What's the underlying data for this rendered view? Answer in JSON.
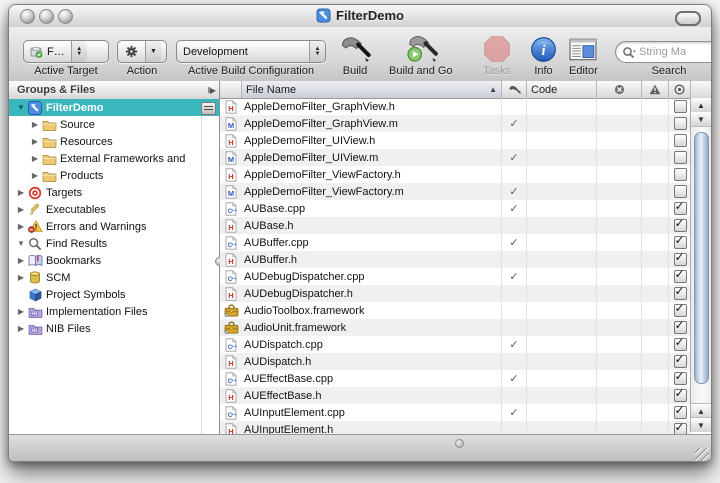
{
  "colors": {
    "selection": "#39b7bd",
    "thumb_blue": "#9db2cc",
    "info_blue": "#2f6fd1"
  },
  "window": {
    "title": "FilterDemo",
    "icon": "xcode-document-icon"
  },
  "toolbar": {
    "active_target": {
      "value": "F…",
      "label": "Active Target",
      "icon": "active-target-icon"
    },
    "action": {
      "label": "Action",
      "icon": "gear-icon"
    },
    "build_config": {
      "value": "Development",
      "label": "Active Build Configuration"
    },
    "build": {
      "label": "Build",
      "icon": "hammer-icon"
    },
    "build_and_go": {
      "label": "Build and Go",
      "icon": "hammer-go-icon"
    },
    "tasks": {
      "label": "Tasks",
      "icon": "stop-octagon-icon",
      "enabled": false
    },
    "info": {
      "label": "Info",
      "icon": "info-icon"
    },
    "editor": {
      "label": "Editor",
      "icon": "editor-window-icon"
    },
    "search": {
      "label": "Search",
      "value": "String Ma",
      "icon": "search-icon"
    }
  },
  "sidebar": {
    "header": "Groups & Files",
    "splitter_icon": "column-split-icon",
    "items": [
      {
        "label": "FilterDemo",
        "icon": "xcode-project-icon",
        "level": 0,
        "disclosure": "expanded",
        "selected": true
      },
      {
        "label": "Source",
        "icon": "folder-icon",
        "level": 1,
        "disclosure": "collapsed",
        "selected": false
      },
      {
        "label": "Resources",
        "icon": "folder-icon",
        "level": 1,
        "disclosure": "collapsed",
        "selected": false
      },
      {
        "label": "External Frameworks and",
        "icon": "folder-icon",
        "level": 1,
        "disclosure": "collapsed",
        "selected": false
      },
      {
        "label": "Products",
        "icon": "folder-icon",
        "level": 1,
        "disclosure": "collapsed",
        "selected": false
      },
      {
        "label": "Targets",
        "icon": "targets-icon",
        "level": 0,
        "disclosure": "collapsed",
        "selected": false
      },
      {
        "label": "Executables",
        "icon": "executables-icon",
        "level": 0,
        "disclosure": "collapsed",
        "selected": false
      },
      {
        "label": "Errors and Warnings",
        "icon": "warnings-icon",
        "level": 0,
        "disclosure": "collapsed",
        "selected": false
      },
      {
        "label": "Find Results",
        "icon": "find-icon",
        "level": 0,
        "disclosure": "expanded",
        "selected": false
      },
      {
        "label": "Bookmarks",
        "icon": "bookmarks-icon",
        "level": 0,
        "disclosure": "collapsed",
        "selected": false
      },
      {
        "label": "SCM",
        "icon": "scm-icon",
        "level": 0,
        "disclosure": "collapsed",
        "selected": false
      },
      {
        "label": "Project Symbols",
        "icon": "symbols-icon",
        "level": 0,
        "disclosure": "none",
        "selected": false
      },
      {
        "label": "Implementation Files",
        "icon": "group-folder-icon",
        "level": 0,
        "disclosure": "collapsed",
        "selected": false
      },
      {
        "label": "NIB Files",
        "icon": "group-folder-icon",
        "level": 0,
        "disclosure": "collapsed",
        "selected": false
      }
    ]
  },
  "table": {
    "file_name_header": "File Name",
    "code_header": "Code",
    "sort_indicator": "▲",
    "check_glyph": "✓",
    "header_icons": [
      "target-hammer-icon",
      "errors-icon",
      "warnings-icon",
      "bullseye-icon"
    ],
    "rows": [
      {
        "name": "AppleDemoFilter_GraphView.h",
        "icon": "header-file-icon",
        "target_check": false,
        "checked": false
      },
      {
        "name": "AppleDemoFilter_GraphView.m",
        "icon": "objc-file-icon",
        "target_check": true,
        "checked": false
      },
      {
        "name": "AppleDemoFilter_UIView.h",
        "icon": "header-file-icon",
        "target_check": false,
        "checked": false
      },
      {
        "name": "AppleDemoFilter_UIView.m",
        "icon": "objc-file-icon",
        "target_check": true,
        "checked": false
      },
      {
        "name": "AppleDemoFilter_ViewFactory.h",
        "icon": "header-file-icon",
        "target_check": false,
        "checked": false
      },
      {
        "name": "AppleDemoFilter_ViewFactory.m",
        "icon": "objc-file-icon",
        "target_check": true,
        "checked": false
      },
      {
        "name": "AUBase.cpp",
        "icon": "cpp-file-icon",
        "target_check": true,
        "checked": true
      },
      {
        "name": "AUBase.h",
        "icon": "header-file-icon",
        "target_check": false,
        "checked": true
      },
      {
        "name": "AUBuffer.cpp",
        "icon": "cpp-file-icon",
        "target_check": true,
        "checked": true
      },
      {
        "name": "AUBuffer.h",
        "icon": "header-file-icon",
        "target_check": false,
        "checked": true
      },
      {
        "name": "AUDebugDispatcher.cpp",
        "icon": "cpp-file-icon",
        "target_check": true,
        "checked": true
      },
      {
        "name": "AUDebugDispatcher.h",
        "icon": "header-file-icon",
        "target_check": false,
        "checked": true
      },
      {
        "name": "AudioToolbox.framework",
        "icon": "framework-icon",
        "target_check": false,
        "checked": true
      },
      {
        "name": "AudioUnit.framework",
        "icon": "framework-icon",
        "target_check": false,
        "checked": true
      },
      {
        "name": "AUDispatch.cpp",
        "icon": "cpp-file-icon",
        "target_check": true,
        "checked": true
      },
      {
        "name": "AUDispatch.h",
        "icon": "header-file-icon",
        "target_check": false,
        "checked": true
      },
      {
        "name": "AUEffectBase.cpp",
        "icon": "cpp-file-icon",
        "target_check": true,
        "checked": true
      },
      {
        "name": "AUEffectBase.h",
        "icon": "header-file-icon",
        "target_check": false,
        "checked": true
      },
      {
        "name": "AUInputElement.cpp",
        "icon": "cpp-file-icon",
        "target_check": true,
        "checked": true
      },
      {
        "name": "AUInputElement.h",
        "icon": "header-file-icon",
        "target_check": false,
        "checked": true
      }
    ]
  }
}
